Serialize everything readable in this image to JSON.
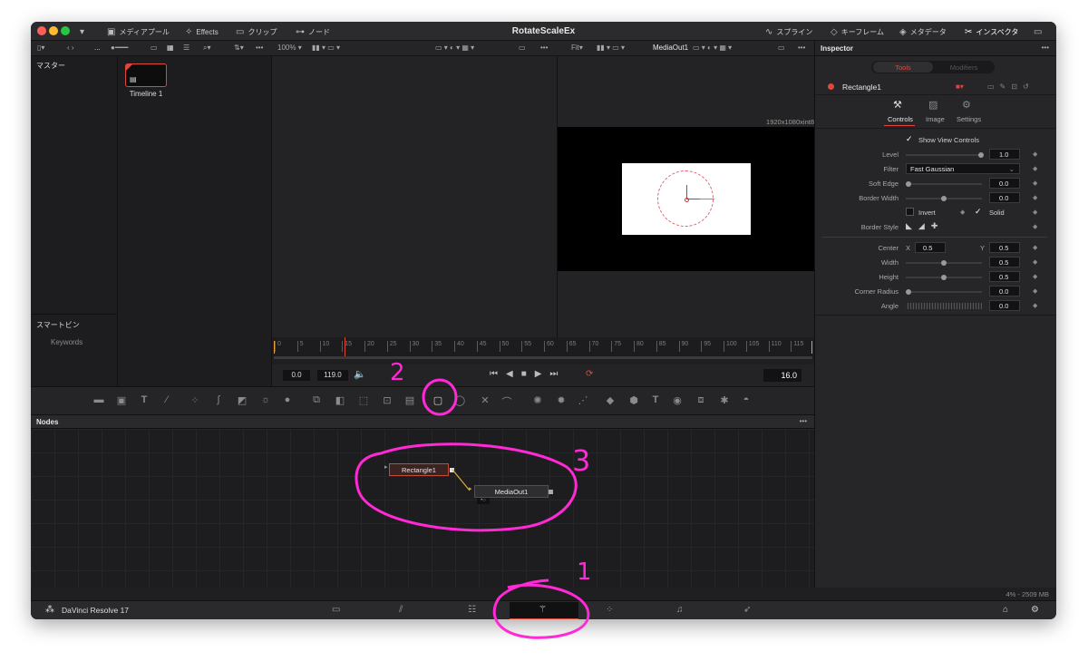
{
  "window": {
    "title": "RotateScaleEx"
  },
  "titlebar": {
    "left": [
      {
        "icon": "media-pool-icon",
        "label": "メディアプール"
      },
      {
        "icon": "effects-icon",
        "label": "Effects"
      },
      {
        "icon": "clips-icon",
        "label": "クリップ"
      },
      {
        "icon": "nodes-icon",
        "label": "ノード"
      }
    ],
    "right": [
      {
        "icon": "spline-icon",
        "label": "スプライン"
      },
      {
        "icon": "keyframes-icon",
        "label": "キーフレーム"
      },
      {
        "icon": "metadata-icon",
        "label": "メタデータ"
      },
      {
        "icon": "inspector-icon",
        "label": "インスペクタ"
      }
    ]
  },
  "toolbar": {
    "dots": "...",
    "zoom": "100%",
    "fit": "Fit",
    "viewer_b_label": "MediaOut1"
  },
  "media_pool": {
    "master_label": "マスター",
    "smart_bins_label": "スマートビン",
    "keywords_label": "Keywords",
    "clip_name": "Timeline 1"
  },
  "viewer": {
    "resolution": "1920x1080xint8"
  },
  "ruler": {
    "ticks": [
      "0",
      "5",
      "10",
      "15",
      "20",
      "25",
      "30",
      "35",
      "40",
      "45",
      "50",
      "55",
      "60",
      "65",
      "70",
      "75",
      "80",
      "85",
      "90",
      "95",
      "100",
      "105",
      "110",
      "115"
    ]
  },
  "transport": {
    "start": "0.0",
    "end": "119.0",
    "current": "16.0"
  },
  "nodes": {
    "title": "Nodes",
    "items": [
      {
        "name": "Rectangle1"
      },
      {
        "name": "MediaOut1"
      }
    ]
  },
  "inspector": {
    "title": "Inspector",
    "tabs": [
      "Tools",
      "Modifiers"
    ],
    "tool_name": "Rectangle1",
    "subtabs": [
      "Controls",
      "Image",
      "Settings"
    ],
    "show_view_controls": "Show View Controls",
    "fields": [
      {
        "label": "Level",
        "value": "1.0",
        "fraction": 1.0
      },
      {
        "label": "Filter",
        "value": "Fast Gaussian"
      },
      {
        "label": "Soft Edge",
        "value": "0.0",
        "fraction": 0.0
      },
      {
        "label": "Border Width",
        "value": "0.0",
        "fraction": 0.5
      }
    ],
    "invert_label": "Invert",
    "solid_label": "Solid",
    "border_style_label": "Border Style",
    "center": {
      "label": "Center",
      "x_label": "X",
      "x": "0.5",
      "y_label": "Y",
      "y": "0.5"
    },
    "fields2": [
      {
        "label": "Width",
        "value": "0.5",
        "fraction": 0.5
      },
      {
        "label": "Height",
        "value": "0.5",
        "fraction": 0.5
      },
      {
        "label": "Corner Radius",
        "value": "0.0",
        "fraction": 0.0
      },
      {
        "label": "Angle",
        "value": "0.0"
      }
    ]
  },
  "status": {
    "memory": "4% - 2509 MB"
  },
  "bottombar": {
    "app_name": "DaVinci Resolve 17"
  },
  "annotations": [
    "1",
    "2",
    "3"
  ],
  "colors": {
    "accent_red": "#e0473c",
    "annotation": "#ff29d6"
  }
}
